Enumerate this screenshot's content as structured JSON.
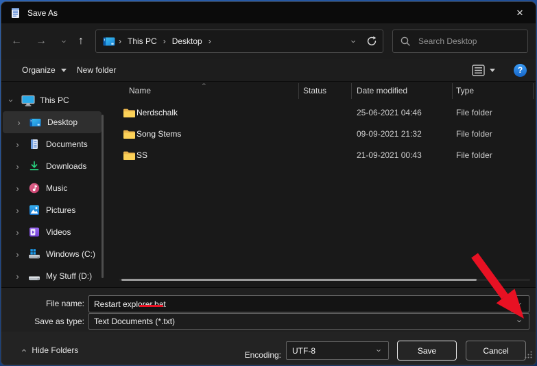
{
  "window": {
    "title": "Save As"
  },
  "icons": {
    "close": "×",
    "back": "←",
    "forward": "→",
    "up": "↑",
    "chevron": "›",
    "question": "?"
  },
  "nav": {
    "breadcrumb_root": "This PC",
    "breadcrumb_child": "Desktop",
    "search_placeholder": "Search Desktop"
  },
  "toolbar": {
    "organize_label": "Organize",
    "new_folder_label": "New folder"
  },
  "sidebar": {
    "items": [
      {
        "label": "This PC"
      },
      {
        "label": "Desktop"
      },
      {
        "label": "Documents"
      },
      {
        "label": "Downloads"
      },
      {
        "label": "Music"
      },
      {
        "label": "Pictures"
      },
      {
        "label": "Videos"
      },
      {
        "label": "Windows (C:)"
      },
      {
        "label": "My Stuff (D:)"
      }
    ]
  },
  "file_list": {
    "columns": {
      "name": "Name",
      "status": "Status",
      "date_modified": "Date modified",
      "type": "Type"
    },
    "rows": [
      {
        "name": "Nerdschalk",
        "status": "",
        "date_modified": "25-06-2021 04:46",
        "type": "File folder"
      },
      {
        "name": "Song Stems",
        "status": "",
        "date_modified": "09-09-2021 21:32",
        "type": "File folder"
      },
      {
        "name": "SS",
        "status": "",
        "date_modified": "21-09-2021 00:43",
        "type": "File folder"
      }
    ]
  },
  "form": {
    "file_name_label": "File name:",
    "file_name_value": "Restart explorer.bat",
    "save_as_type_label": "Save as type:",
    "save_as_type_value": "Text Documents (*.txt)"
  },
  "footer": {
    "hide_folders_label": "Hide Folders",
    "encoding_label": "Encoding:",
    "encoding_value": "UTF-8",
    "save_label": "Save",
    "cancel_label": "Cancel"
  },
  "colors": {
    "annotation_red": "#e81123",
    "folder_yellow": "#fbd158",
    "help_blue": "#2b88e8"
  }
}
